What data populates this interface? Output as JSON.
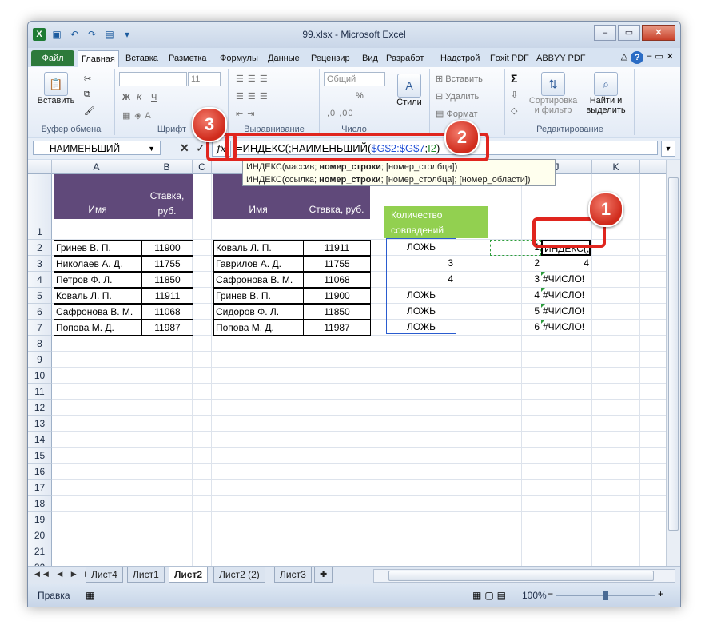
{
  "window": {
    "title": "99.xlsx - Microsoft Excel"
  },
  "ribbon_tabs": [
    "Файл",
    "Главная",
    "Вставка",
    "Разметка",
    "Формулы",
    "Данные",
    "Рецензир",
    "Вид",
    "Разработ",
    "Надстрой",
    "Foxit PDF",
    "ABBYY PDF"
  ],
  "ribbon": {
    "paste": "Вставить",
    "clipboard": "Буфер обмена",
    "font_size": "11",
    "font": "Шрифт",
    "alignment": "Выравнивание",
    "number_format": "Общий",
    "number": "Число",
    "styles": "Стили",
    "insert": "Вставить",
    "delete": "Удалить",
    "format": "Формат",
    "sort_filter_1": "Сортировка",
    "sort_filter_2": "и фильтр",
    "find_select_1": "Найти и",
    "find_select_2": "выделить",
    "editing": "Редактирование",
    "bold": "Ж",
    "italic": "К",
    "underline": "Ч",
    "sigma": "Σ",
    "percent": "%"
  },
  "formula_bar": {
    "name_box": "НАИМЕНЬШИЙ",
    "formula_prefix": "=ИНДЕКС(;НАИМЕНЬШИЙ(",
    "formula_range": "$G$2:$G$7",
    "formula_sep": ";",
    "formula_ref": "I2",
    "formula_suffix": ")",
    "tooltip_line1_a": "ИНДЕКС(массив; ",
    "tooltip_line1_b": "номер_строки",
    "tooltip_line1_c": "; [номер_столбца])",
    "tooltip_line2_a": "ИНДЕКС(ссылка; ",
    "tooltip_line2_b": "номер_строки",
    "tooltip_line2_c": "; [номер_столбца]; [номер_области])"
  },
  "columns": [
    "A",
    "B",
    "C",
    "J",
    "K"
  ],
  "rows": [
    "1",
    "2",
    "3",
    "4",
    "5",
    "6",
    "7",
    "8",
    "9",
    "10",
    "11",
    "12",
    "13",
    "14",
    "15",
    "16",
    "17",
    "18",
    "19",
    "20",
    "21",
    "22"
  ],
  "table1": {
    "headers": [
      "Имя",
      "Ставка,",
      "руб."
    ],
    "rows": [
      [
        "Гринев В. П.",
        "11900"
      ],
      [
        "Николаев А. Д.",
        "11755"
      ],
      [
        "Петров Ф. Л.",
        "11850"
      ],
      [
        "Коваль Л. П.",
        "11911"
      ],
      [
        "Сафронова В. М.",
        "11068"
      ],
      [
        "Попова М. Д.",
        "11987"
      ]
    ]
  },
  "table2": {
    "headers": [
      "Имя",
      "Ставка, руб."
    ],
    "rows": [
      [
        "Коваль Л. П.",
        "11911"
      ],
      [
        "Гаврилов А. Д.",
        "11755"
      ],
      [
        "Сафронова В. М.",
        "11068"
      ],
      [
        "Гринев В. П.",
        "11900"
      ],
      [
        "Сидоров Ф. Л.",
        "11850"
      ],
      [
        "Попова М. Д.",
        "11987"
      ]
    ]
  },
  "match": {
    "header1": "Количество",
    "header2": "совпадений",
    "values": [
      "ЛОЖЬ",
      "3",
      "4",
      "ЛОЖЬ",
      "ЛОЖЬ",
      "ЛОЖЬ"
    ]
  },
  "col_i": [
    "1",
    "2",
    "3",
    "4",
    "5",
    "6"
  ],
  "col_j": [
    "ИНДЕКС(;НА",
    "4",
    "#ЧИСЛО!",
    "#ЧИСЛО!",
    "#ЧИСЛО!",
    "#ЧИСЛО!"
  ],
  "sheets": [
    "Лист4",
    "Лист1",
    "Лист2",
    "Лист2 (2)",
    "Лист3"
  ],
  "status": {
    "mode": "Правка",
    "zoom": "100%"
  },
  "callouts": [
    "1",
    "2",
    "3"
  ],
  "colors": {
    "header_purple": "#60497a",
    "header_green": "#92d050",
    "callout_red": "#e0251e",
    "file_tab": "#2d7a3b"
  }
}
